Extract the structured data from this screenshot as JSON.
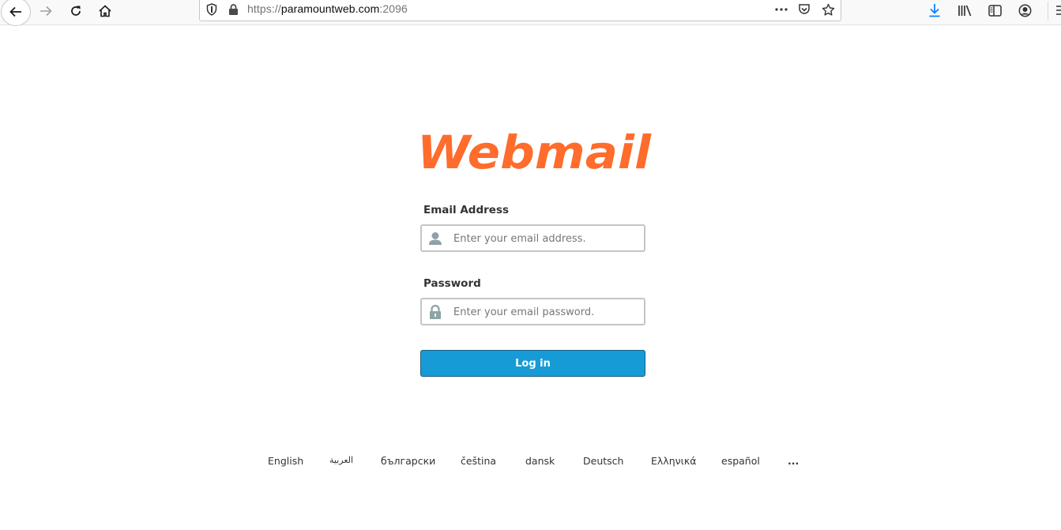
{
  "browser": {
    "url_scheme": "https://",
    "url_host": "paramountweb.com",
    "url_port": ":2096",
    "icons": {
      "back": "arrow-left-icon",
      "forward": "arrow-right-icon",
      "reload": "reload-icon",
      "home": "home-icon",
      "tracking": "shield-icon",
      "lock": "lock-icon",
      "page_actions": "more-icon",
      "pocket": "pocket-icon",
      "bookmark": "star-icon",
      "downloads": "download-icon",
      "library": "library-icon",
      "sidebar": "sidebar-icon",
      "account": "account-icon",
      "menu": "menu-icon"
    },
    "colors": {
      "download_accent": "#0a84ff"
    }
  },
  "login": {
    "logo_text": "Webmail",
    "email_label": "Email Address",
    "email_placeholder": "Enter your email address.",
    "email_value": "",
    "password_label": "Password",
    "password_placeholder": "Enter your email password.",
    "password_value": "",
    "submit_label": "Log in",
    "colors": {
      "brand_orange": "#ff6c2c",
      "button_blue": "#179bd7",
      "icon_gray": "#8fa3a6"
    }
  },
  "languages": [
    "English",
    "العربية",
    "български",
    "čeština",
    "dansk",
    "Deutsch",
    "Ελληνικά",
    "español",
    "..."
  ]
}
